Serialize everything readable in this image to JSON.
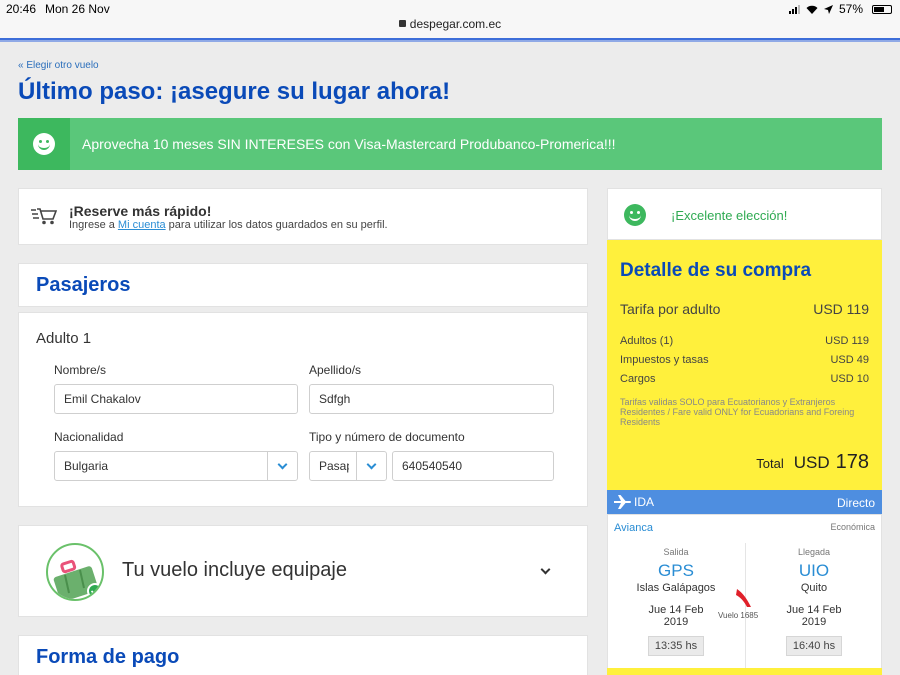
{
  "status": {
    "time": "20:46",
    "date": "Mon 26 Nov",
    "battery": "57%",
    "url": "despegar.com.ec"
  },
  "nav": {
    "back_link": "« Elegir otro vuelo"
  },
  "page_title": "Último paso: ¡asegure su lugar ahora!",
  "promo": {
    "text": "Aprovecha 10 meses SIN INTERESES con Visa-Mastercard Produbanco-Promerica!!!"
  },
  "quick": {
    "title": "¡Reserve más rápido!",
    "sub_before": "Ingrese a ",
    "link": "Mi cuenta",
    "sub_after": " para utilizar los datos guardados en su perfil."
  },
  "passengers": {
    "title": "Pasajeros",
    "adult_label": "Adulto 1",
    "first_name_label": "Nombre/s",
    "first_name": "Emil Chakalov",
    "last_name_label": "Apellido/s",
    "last_name": "Sdfgh",
    "nationality_label": "Nacionalidad",
    "nationality": "Bulgaria",
    "document_label": "Tipo y número de documento",
    "document_type": "Pasaporte",
    "document_number": "640540540"
  },
  "baggage": {
    "title": "Tu vuelo incluye equipaje"
  },
  "payment": {
    "title": "Forma de pago"
  },
  "summary": {
    "excellent": "¡Excelente elección!",
    "title": "Detalle de su compra",
    "fare_label": "Tarifa por adulto",
    "fare_value": "USD 119",
    "adults_label": "Adultos (1)",
    "adults_value": "USD 119",
    "taxes_label": "Impuestos y tasas",
    "taxes_value": "USD 49",
    "charges_label": "Cargos",
    "charges_value": "USD 10",
    "note": "Tarifas validas SOLO para Ecuatorianos y Extranjeros Residentes / Fare valid ONLY for Ecuadorians and Foreing Residents",
    "total_label": "Total",
    "total_currency": "USD",
    "total_value": "178"
  },
  "flight": {
    "direction": "IDA",
    "type": "Directo",
    "airline": "Avianca",
    "cabin": "Económica",
    "departure": {
      "label": "Salida",
      "code": "GPS",
      "city": "Islas Galápagos",
      "date": "Jue 14 Feb 2019",
      "time": "13:35 hs"
    },
    "arrival": {
      "label": "Llegada",
      "code": "UIO",
      "city": "Quito",
      "date": "Jue 14 Feb 2019",
      "time": "16:40 hs"
    },
    "number": "Vuelo 1685"
  },
  "colors": {
    "primary_blue": "#0a4ab8",
    "promo_green": "#5ac77a",
    "summary_yellow": "#fff03c",
    "link_blue": "#2a8dd4",
    "ida_blue": "#4e8ee0"
  }
}
